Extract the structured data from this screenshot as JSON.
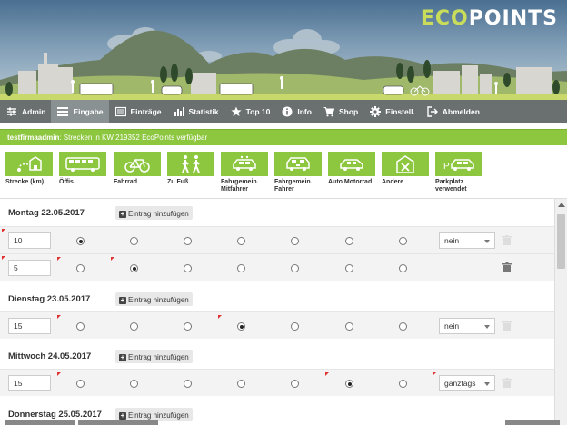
{
  "app": {
    "logo_eco": "ECO",
    "logo_points": "POINTS"
  },
  "nav": {
    "items": [
      {
        "label": "Admin",
        "icon": "sliders-icon",
        "active": false
      },
      {
        "label": "Eingabe",
        "icon": "list-icon",
        "active": true
      },
      {
        "label": "Einträge",
        "icon": "entries-icon",
        "active": false
      },
      {
        "label": "Statistik",
        "icon": "bar-chart-icon",
        "active": false
      },
      {
        "label": "Top 10",
        "icon": "star-icon",
        "active": false
      },
      {
        "label": "Info",
        "icon": "info-icon",
        "active": false
      },
      {
        "label": "Shop",
        "icon": "cart-icon",
        "active": false
      },
      {
        "label": "Einstell.",
        "icon": "gear-icon",
        "active": false
      },
      {
        "label": "Abmelden",
        "icon": "logout-icon",
        "active": false
      }
    ]
  },
  "info": {
    "user": "testfirmaadmin",
    "message": ": Strecken in KW 219352 EcoPoints verfügbar"
  },
  "modes": [
    {
      "label": "Strecke (km)",
      "icon": "distance-icon"
    },
    {
      "label": "Öffis",
      "icon": "bus-icon"
    },
    {
      "label": "Fahrrad",
      "icon": "bicycle-icon"
    },
    {
      "label": "Zu Fuß",
      "icon": "pedestrians-icon"
    },
    {
      "label": "Fahrgemein. Mitfahrer",
      "icon": "carpool-passenger-icon"
    },
    {
      "label": "Fahrgemein. Fahrer",
      "icon": "carpool-driver-icon"
    },
    {
      "label": "Auto Motorrad",
      "icon": "car-icon"
    },
    {
      "label": "Andere",
      "icon": "other-icon"
    },
    {
      "label": "Parkplatz verwendet",
      "icon": "parking-car-icon"
    }
  ],
  "add_label": "Eintrag hinzufügen",
  "days": [
    {
      "title": "Montag 22.05.2017",
      "rows": [
        {
          "km": "10",
          "selected": 0,
          "parking": "nein"
        },
        {
          "km": "5",
          "selected": 1,
          "parking": ""
        }
      ]
    },
    {
      "title": "Dienstag 23.05.2017",
      "rows": [
        {
          "km": "15",
          "selected": 3,
          "parking": "nein"
        }
      ]
    },
    {
      "title": "Mittwoch 24.05.2017",
      "rows": [
        {
          "km": "15",
          "selected": 5,
          "parking": "ganztags"
        }
      ]
    },
    {
      "title": "Donnerstag 25.05.2017",
      "rows": []
    }
  ],
  "colors": {
    "accent": "#8dc63f",
    "nav_bg": "#6a6f70",
    "nav_active": "#8a9193"
  }
}
